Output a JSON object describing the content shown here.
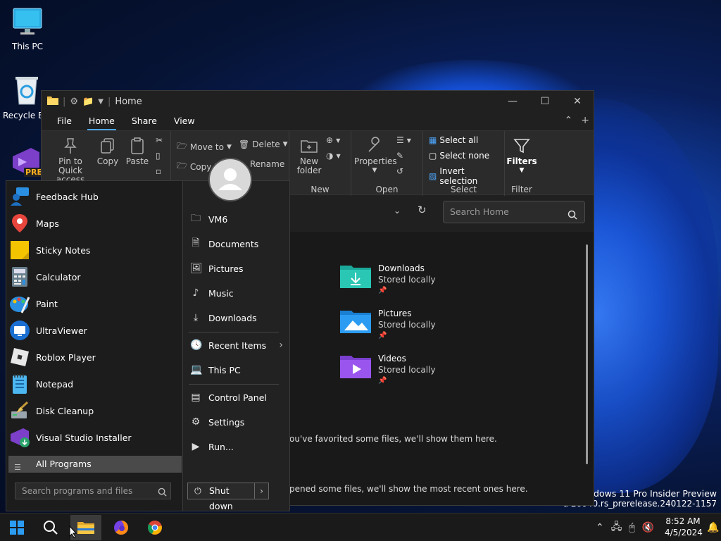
{
  "desktop": {
    "icons": [
      {
        "label": "This PC"
      },
      {
        "label": "Recycle Bin"
      },
      {
        "label": "PRE"
      }
    ],
    "watermark": {
      "line1": "Windows 11 Pro Insider Preview",
      "line2": "d 26040.rs_prerelease.240122-1157"
    }
  },
  "explorer": {
    "title": "Home",
    "menu": [
      "File",
      "Home",
      "Share",
      "View"
    ],
    "active_tab": "Home",
    "ribbon": {
      "clipboard": {
        "pin": "Pin to Quick access",
        "copy": "Copy",
        "paste": "Paste"
      },
      "organize": {
        "move_to": "Move to",
        "copy_to": "Copy to",
        "delete": "Delete",
        "rename": "Rename"
      },
      "new": {
        "new_folder": "New folder",
        "group": "New"
      },
      "open": {
        "properties": "Properties",
        "group": "Open"
      },
      "select": {
        "select_all": "Select all",
        "select_none": "Select none",
        "invert": "Invert selection",
        "group": "Select"
      },
      "filter": {
        "filters": "Filters",
        "group": "Filter"
      }
    },
    "search_placeholder": "Search Home",
    "favorites": [
      {
        "name": "Downloads",
        "sub": "Stored locally"
      },
      {
        "name": "Pictures",
        "sub": "Stored locally"
      },
      {
        "name": "Videos",
        "sub": "Stored locally"
      }
    ],
    "notes": {
      "favorites": "ou've favorited some files, we'll show them here.",
      "recent": "pened some files, we'll show the most recent ones here."
    }
  },
  "start_menu": {
    "programs": [
      {
        "label": "Feedback Hub"
      },
      {
        "label": "Maps"
      },
      {
        "label": "Sticky Notes"
      },
      {
        "label": "Calculator"
      },
      {
        "label": "Paint"
      },
      {
        "label": "UltraViewer"
      },
      {
        "label": "Roblox Player"
      },
      {
        "label": "Notepad"
      },
      {
        "label": "Disk Cleanup"
      },
      {
        "label": "Visual Studio Installer"
      }
    ],
    "all_programs": "All Programs",
    "search_placeholder": "Search programs and files",
    "right": {
      "user": "VM6",
      "documents": "Documents",
      "pictures": "Pictures",
      "music": "Music",
      "downloads": "Downloads",
      "recent": "Recent Items",
      "thispc": "This PC",
      "control": "Control Panel",
      "settings": "Settings",
      "run": "Run..."
    },
    "shutdown": "Shut down"
  },
  "taskbar": {
    "time": "8:52 AM",
    "date": "4/5/2024"
  }
}
